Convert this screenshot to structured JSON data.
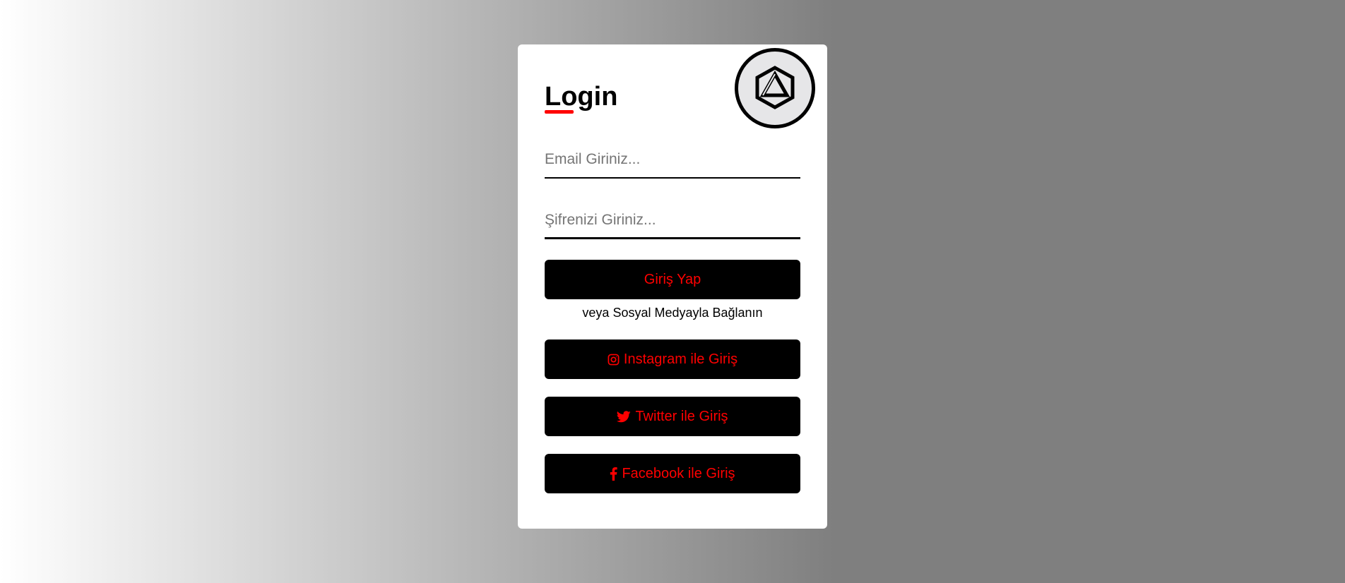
{
  "login": {
    "title": "Login",
    "email_placeholder": "Email Giriniz...",
    "password_placeholder": "Şifrenizi Giriniz...",
    "submit_label": "Giriş Yap",
    "social_text": "veya Sosyal Medyayla Bağlanın",
    "instagram_label": "Instagram ile Giriş",
    "twitter_label": "Twitter ile Giriş",
    "facebook_label": "Facebook ile Giriş"
  },
  "icons": {
    "logo": "hexagon-triangle-logo",
    "instagram": "instagram-icon",
    "twitter": "twitter-icon",
    "facebook": "facebook-icon"
  },
  "colors": {
    "accent": "#ff0000",
    "button_bg": "#000000",
    "card_bg": "#ffffff",
    "logo_bg": "#e6e6e8"
  }
}
